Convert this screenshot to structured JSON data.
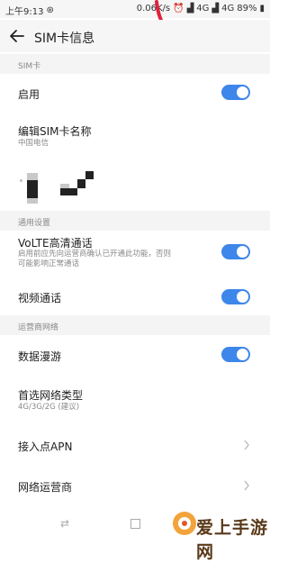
{
  "status_bar": {
    "time": "上午9:13",
    "speed": "0.06K/s",
    "network_1": "4G",
    "network_2": "4G",
    "battery": "89%"
  },
  "header": {
    "title": "SIM卡信息"
  },
  "sections": {
    "sim": {
      "header": "SIM卡",
      "enable_label": "启用",
      "enable_on": true,
      "edit_name_label": "编辑SIM卡名称",
      "edit_name_value": "中国电信"
    },
    "general": {
      "header": "通用设置",
      "volte_label": "VoLTE高清通话",
      "volte_desc_line1": "启用前应先向运营商确认已开通此功能，否则",
      "volte_desc_line2": "可能影响正常通话",
      "volte_on": true,
      "video_call_label": "视频通话",
      "video_call_on": true
    },
    "carrier": {
      "header": "运营商网络",
      "data_roaming_label": "数据漫游",
      "data_roaming_on": true,
      "preferred_network_label": "首选网络类型",
      "preferred_network_value": "4G/3G/2G (建议)",
      "apn_label": "接入点APN",
      "operator_label": "网络运营商"
    }
  },
  "watermark": {
    "text": "爱上手游网"
  },
  "colors": {
    "accent": "#3d86ea",
    "annotation_red": "#e0213a"
  }
}
